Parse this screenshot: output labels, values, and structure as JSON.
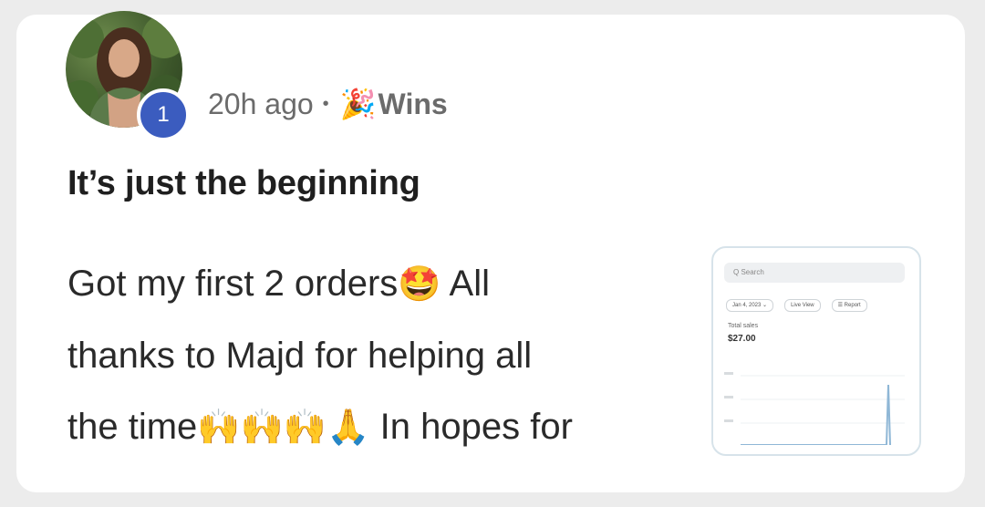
{
  "post": {
    "author_level": "1",
    "time_ago": "20h ago",
    "separator": "•",
    "category_icon": "party-popper-icon",
    "category_emoji": "🎉",
    "category": "Wins",
    "title": "It’s just the beginning",
    "body": {
      "line1_text": "Got my first 2 orders",
      "line1_emoji": "🤩",
      "line1_tail": " All",
      "line2_text": "thanks to Majd for helping all",
      "line3_text": "the time",
      "line3_emoji": "🙌🙌🙌🙏",
      "line3_tail": " In hopes for"
    }
  },
  "attachment": {
    "search_placeholder": "Q Search",
    "chips": [
      "Jan 4, 2023 ⌄",
      "Live View",
      "☰ Report"
    ],
    "stat_label": "Total sales",
    "stat_value": "$27.00"
  },
  "colors": {
    "badge": "#3b5cbf",
    "text": "#2a2a2a",
    "meta": "#6b6b6b",
    "thumb_border": "#d7e3ea",
    "chart_line": "#8fb7d6"
  }
}
